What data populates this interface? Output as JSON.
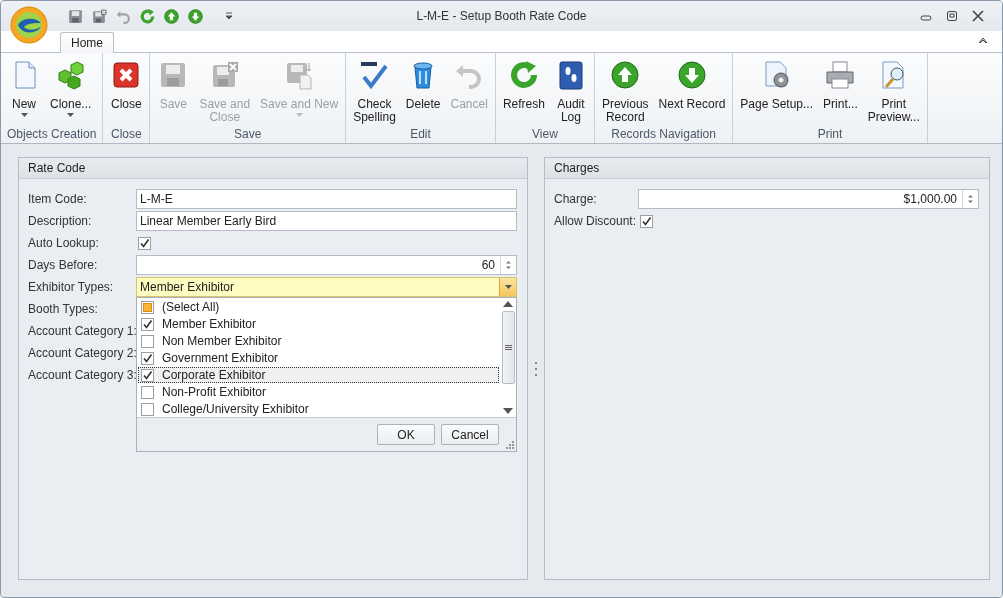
{
  "window": {
    "title": "L-M-E - Setup Booth Rate Code"
  },
  "tabs": [
    {
      "label": "Home",
      "selected": true
    }
  ],
  "ribbon": {
    "groups": [
      {
        "label": "Objects Creation",
        "buttons": [
          {
            "label": "New",
            "kind": "new",
            "disabled": false,
            "dropdown": true,
            "wrap": false
          },
          {
            "label": "Clone...",
            "kind": "clone",
            "disabled": false,
            "dropdown": true,
            "wrap": false
          }
        ]
      },
      {
        "label": "Close",
        "buttons": [
          {
            "label": "Close",
            "kind": "close",
            "disabled": false,
            "dropdown": false,
            "wrap": false
          }
        ]
      },
      {
        "label": "Save",
        "buttons": [
          {
            "label": "Save",
            "kind": "save",
            "disabled": true,
            "dropdown": false,
            "wrap": false
          },
          {
            "label": "Save and Close",
            "kind": "save-close",
            "disabled": true,
            "dropdown": false,
            "wrap": true
          },
          {
            "label": "Save and New",
            "kind": "save-new",
            "disabled": true,
            "dropdown": true,
            "wrap": false
          }
        ]
      },
      {
        "label": "Edit",
        "buttons": [
          {
            "label": "Check Spelling",
            "kind": "spell",
            "disabled": false,
            "dropdown": false,
            "wrap": true
          },
          {
            "label": "Delete",
            "kind": "delete",
            "disabled": false,
            "dropdown": false,
            "wrap": false
          },
          {
            "label": "Cancel",
            "kind": "undo",
            "disabled": true,
            "dropdown": false,
            "wrap": false
          }
        ]
      },
      {
        "label": "View",
        "buttons": [
          {
            "label": "Refresh",
            "kind": "refresh",
            "disabled": false,
            "dropdown": false,
            "wrap": false
          },
          {
            "label": "Audit Log",
            "kind": "log",
            "disabled": false,
            "dropdown": false,
            "wrap": true
          }
        ]
      },
      {
        "label": "Records Navigation",
        "buttons": [
          {
            "label": "Previous Record",
            "kind": "up",
            "disabled": false,
            "dropdown": false,
            "wrap": true
          },
          {
            "label": "Next Record",
            "kind": "down",
            "disabled": false,
            "dropdown": false,
            "wrap": false
          }
        ]
      },
      {
        "label": "Print",
        "buttons": [
          {
            "label": "Page Setup...",
            "kind": "page-setup",
            "disabled": false,
            "dropdown": false,
            "wrap": false
          },
          {
            "label": "Print...",
            "kind": "print",
            "disabled": false,
            "dropdown": false,
            "wrap": false
          },
          {
            "label": "Print Preview...",
            "kind": "preview",
            "disabled": false,
            "dropdown": false,
            "wrap": true
          }
        ]
      }
    ]
  },
  "rate_code": {
    "title": "Rate Code",
    "fields": [
      {
        "kind": "text",
        "label": "Item Code:",
        "value": "L-M-E"
      },
      {
        "kind": "text",
        "label": "Description:",
        "value": "Linear Member Early Bird"
      },
      {
        "kind": "checkbox",
        "label": "Auto Lookup:",
        "checked": true
      },
      {
        "kind": "spin",
        "label": "Days Before:",
        "value": "60"
      },
      {
        "kind": "combo",
        "label": "Exhibitor Types:",
        "value": "Member Exhibitor",
        "expanded": true
      },
      {
        "kind": "covered",
        "label": "Booth Types:"
      },
      {
        "kind": "covered",
        "label": "Account Category 1:"
      },
      {
        "kind": "covered",
        "label": "Account Category 2:"
      },
      {
        "kind": "covered",
        "label": "Account Category 3:"
      }
    ]
  },
  "exhibitor_dropdown": {
    "items": [
      {
        "label": "(Select All)",
        "checked": false,
        "partial": true,
        "selected": false
      },
      {
        "label": "Member Exhibitor",
        "checked": true,
        "partial": false,
        "selected": false
      },
      {
        "label": "Non Member Exhibitor",
        "checked": false,
        "partial": false,
        "selected": false
      },
      {
        "label": "Government Exhibitor",
        "checked": true,
        "partial": false,
        "selected": false
      },
      {
        "label": "Corporate Exhibitor",
        "checked": true,
        "partial": false,
        "selected": true
      },
      {
        "label": "Non-Profit Exhibitor",
        "checked": false,
        "partial": false,
        "selected": false
      },
      {
        "label": "College/University Exhibitor",
        "checked": false,
        "partial": false,
        "selected": false
      }
    ],
    "buttons": [
      "OK",
      "Cancel"
    ]
  },
  "charges": {
    "title": "Charges",
    "fields": [
      {
        "kind": "spin",
        "label": "Charge:",
        "value": "$1,000.00"
      },
      {
        "kind": "checkbox",
        "label": "Allow Discount:",
        "checked": true
      }
    ]
  }
}
